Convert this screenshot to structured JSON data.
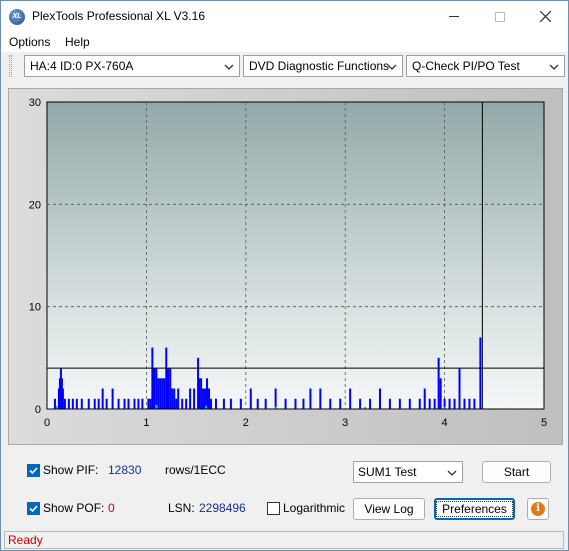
{
  "window": {
    "title": "PlexTools Professional XL V3.16",
    "icon_text": "XL"
  },
  "menu": {
    "items": [
      "Options",
      "Help"
    ]
  },
  "toolbar": {
    "drive": "HA:4 ID:0  PX-760A",
    "function": "DVD Diagnostic Functions",
    "test": "Q-Check PI/PO Test"
  },
  "chart_data": {
    "type": "bar",
    "xlim": [
      0,
      5
    ],
    "ylim": [
      0,
      30
    ],
    "x_ticks": [
      "0",
      "1",
      "2",
      "3",
      "4",
      "5"
    ],
    "y_ticks": [
      "0",
      "10",
      "20",
      "30"
    ],
    "threshold_line": 4,
    "marker_x": 4.38,
    "grid": true,
    "series": [
      {
        "color": "#0000ff",
        "points": [
          [
            0.08,
            1
          ],
          [
            0.12,
            2
          ],
          [
            0.13,
            3
          ],
          [
            0.14,
            4
          ],
          [
            0.15,
            3
          ],
          [
            0.16,
            2
          ],
          [
            0.18,
            1
          ],
          [
            0.22,
            1
          ],
          [
            0.26,
            1
          ],
          [
            0.3,
            1
          ],
          [
            0.35,
            1
          ],
          [
            0.42,
            1
          ],
          [
            0.48,
            1
          ],
          [
            0.52,
            1
          ],
          [
            0.56,
            2
          ],
          [
            0.6,
            1
          ],
          [
            0.66,
            2
          ],
          [
            0.72,
            1
          ],
          [
            0.78,
            1
          ],
          [
            0.82,
            1
          ],
          [
            0.88,
            1
          ],
          [
            0.92,
            1
          ],
          [
            0.96,
            1
          ],
          [
            1.02,
            1
          ],
          [
            1.04,
            1
          ],
          [
            1.06,
            6
          ],
          [
            1.07,
            4
          ],
          [
            1.08,
            4
          ],
          [
            1.1,
            4
          ],
          [
            1.12,
            3
          ],
          [
            1.14,
            3
          ],
          [
            1.16,
            3
          ],
          [
            1.18,
            3
          ],
          [
            1.2,
            6
          ],
          [
            1.21,
            4
          ],
          [
            1.22,
            4
          ],
          [
            1.24,
            4
          ],
          [
            1.26,
            2
          ],
          [
            1.28,
            2
          ],
          [
            1.3,
            1
          ],
          [
            1.32,
            2
          ],
          [
            1.36,
            1
          ],
          [
            1.4,
            1
          ],
          [
            1.44,
            2
          ],
          [
            1.48,
            2
          ],
          [
            1.52,
            5
          ],
          [
            1.53,
            3
          ],
          [
            1.55,
            3
          ],
          [
            1.57,
            2
          ],
          [
            1.59,
            2
          ],
          [
            1.61,
            3
          ],
          [
            1.63,
            2
          ],
          [
            1.65,
            1
          ],
          [
            1.7,
            1
          ],
          [
            1.78,
            1
          ],
          [
            1.85,
            1
          ],
          [
            1.95,
            1
          ],
          [
            2.05,
            2
          ],
          [
            2.12,
            1
          ],
          [
            2.2,
            1
          ],
          [
            2.3,
            2
          ],
          [
            2.4,
            1
          ],
          [
            2.5,
            1
          ],
          [
            2.58,
            1
          ],
          [
            2.65,
            2
          ],
          [
            2.75,
            2
          ],
          [
            2.85,
            1
          ],
          [
            2.95,
            1
          ],
          [
            3.05,
            2
          ],
          [
            3.15,
            1
          ],
          [
            3.25,
            1
          ],
          [
            3.35,
            2
          ],
          [
            3.45,
            1
          ],
          [
            3.55,
            1
          ],
          [
            3.65,
            1
          ],
          [
            3.75,
            1
          ],
          [
            3.8,
            2
          ],
          [
            3.85,
            1
          ],
          [
            3.9,
            1
          ],
          [
            3.94,
            5
          ],
          [
            3.96,
            3
          ],
          [
            4.0,
            1
          ],
          [
            4.05,
            1
          ],
          [
            4.1,
            1
          ],
          [
            4.15,
            4
          ],
          [
            4.2,
            1
          ],
          [
            4.25,
            1
          ],
          [
            4.3,
            1
          ],
          [
            4.36,
            7
          ]
        ]
      },
      {
        "color": "#00c8c8",
        "points": [
          [
            0.1,
            0.3
          ],
          [
            1.1,
            0.4
          ],
          [
            1.6,
            0.3
          ],
          [
            2.3,
            0.2
          ],
          [
            3.2,
            0.2
          ],
          [
            4.0,
            0.2
          ]
        ]
      }
    ]
  },
  "controls": {
    "show_pif_label": "Show PIF:",
    "pif_value": "12830",
    "pif_unit": "rows/1ECC",
    "show_pof_label": "Show POF:",
    "pof_value": "0",
    "lsn_label": "LSN:",
    "lsn_value": "2298496",
    "logarithmic_label": "Logarithmic",
    "sum_test": "SUM1 Test",
    "start_button": "Start",
    "view_log_button": "View Log",
    "preferences_button": "Preferences",
    "info_symbol": "i",
    "show_pif_checked": true,
    "show_pof_checked": true,
    "logarithmic_checked": false
  },
  "status": {
    "text": "Ready"
  }
}
